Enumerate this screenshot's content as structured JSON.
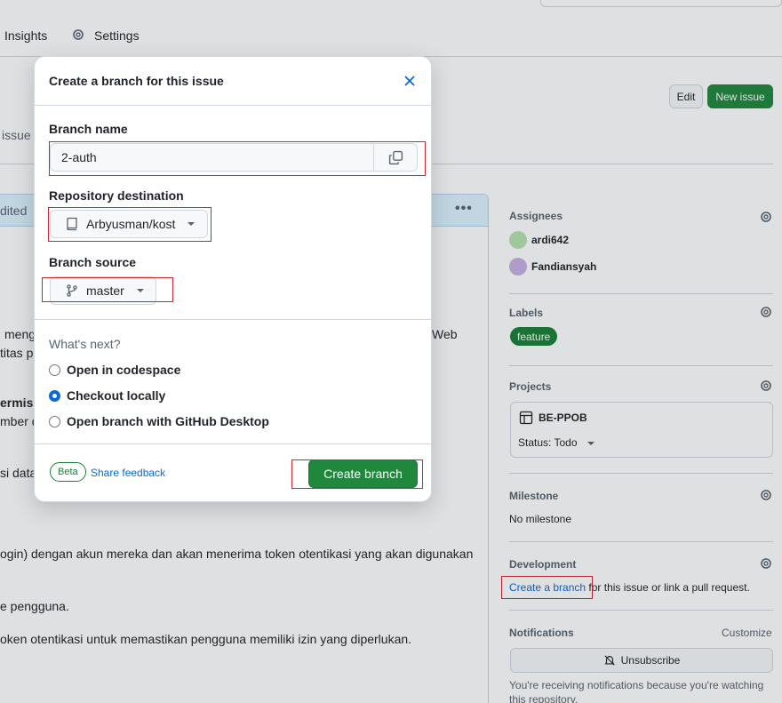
{
  "nav": {
    "insights_label": "Insights",
    "settings_label": "Settings"
  },
  "header_actions": {
    "edit_label": "Edit",
    "new_issue_label": "New issue"
  },
  "background": {
    "issue_fragment": "issue",
    "edited_fragment": "dited",
    "kebab": "•••",
    "lines": [
      "meng",
      "Web",
      "titas pe",
      "ermiss",
      "mber da",
      "si data",
      "ogin) dengan akun mereka dan akan menerima token otentikasi yang akan digunakan",
      "e pengguna.",
      "oken otentikasi untuk memastikan pengguna memiliki izin yang diperlukan."
    ]
  },
  "sidebar": {
    "assignees_title": "Assignees",
    "assignees": [
      "ardi642",
      "Fandiansyah"
    ],
    "labels_title": "Labels",
    "label": "feature",
    "projects_title": "Projects",
    "project_name": "BE-PPOB",
    "project_status": "Status: Todo",
    "milestone_title": "Milestone",
    "milestone_value": "No milestone",
    "development_title": "Development",
    "create_branch_link": "Create a branch",
    "development_rest": " for this issue or link a pull request.",
    "notifications_title": "Notifications",
    "customize_label": "Customize",
    "unsubscribe_label": "Unsubscribe",
    "notify_text": "You're receiving notifications because you're watching this repository."
  },
  "dialog": {
    "title": "Create a branch for this issue",
    "branch_name_label": "Branch name",
    "branch_name_value": "2-auth",
    "repo_label": "Repository destination",
    "repo_value": "Arbyusman/kost",
    "source_label": "Branch source",
    "source_value": "master",
    "whats_next": "What's next?",
    "options": [
      {
        "label": "Open in codespace",
        "checked": false
      },
      {
        "label": "Checkout locally",
        "checked": true
      },
      {
        "label": "Open branch with GitHub Desktop",
        "checked": false
      }
    ],
    "beta_label": "Beta",
    "share_feedback_label": "Share feedback",
    "create_button_label": "Create branch"
  },
  "colors": {
    "primary_green": "#1f883d",
    "link_blue": "#0969da",
    "highlight_red": "#d1242f"
  }
}
